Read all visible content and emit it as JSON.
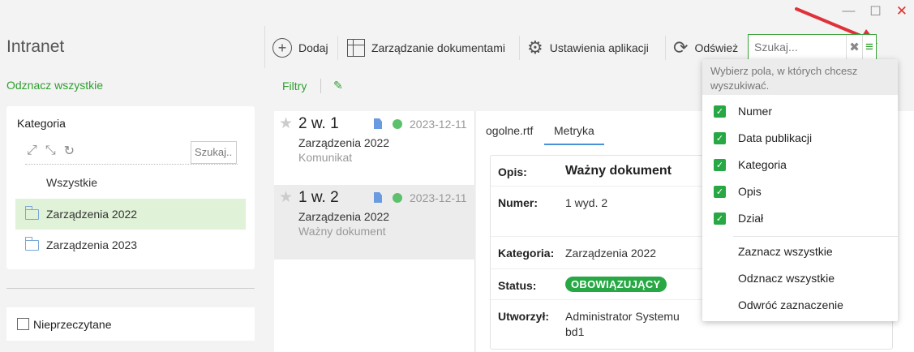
{
  "window": {
    "minimize": "—",
    "maximize": "☐",
    "close": "✕"
  },
  "app": {
    "title": "Intranet"
  },
  "left": {
    "uncheck_all": "Odznacz wszystkie",
    "category_title": "Kategoria",
    "category_search_placeholder": "Szukaj..",
    "categories": [
      "Wszystkie",
      "Zarządzenia 2022",
      "Zarządzenia 2023"
    ],
    "unread_label": "Nieprzeczytane"
  },
  "toolbar": {
    "add": "Dodaj",
    "manage_docs": "Zarządzanie dokumentami",
    "app_settings": "Ustawienia aplikacji",
    "refresh": "Odśwież",
    "search_placeholder": "Szukaj..."
  },
  "filters": {
    "label": "Filtry"
  },
  "documents": [
    {
      "number": "2 w. 1",
      "date": "2023-12-11",
      "category": "Zarządzenia 2022",
      "description": "Komunikat"
    },
    {
      "number": "1 w. 2",
      "date": "2023-12-11",
      "category": "Zarządzenia 2022",
      "description": "Ważny dokument"
    }
  ],
  "tabs": [
    "ogolne.rtf",
    "Metryka"
  ],
  "metadata": {
    "opis_label": "Opis:",
    "opis_value": "Ważny dokument",
    "numer_label": "Numer:",
    "numer_value": "1 wyd. 2",
    "kategoria_label": "Kategoria:",
    "kategoria_value": "Zarządzenia 2022",
    "status_label": "Status:",
    "status_value": "OBOWIĄZUJĄCY",
    "utworzyl_label": "Utworzył:",
    "utworzyl_value_1": "Administrator Systemu",
    "utworzyl_value_2": "bd1"
  },
  "search_fields_menu": {
    "header": "Wybierz pola, w których chcesz wyszukiwać.",
    "fields": [
      "Numer",
      "Data publikacji",
      "Kategoria",
      "Opis",
      "Dział"
    ],
    "actions": [
      "Zaznacz wszystkie",
      "Odznacz wszystkie",
      "Odwróć zaznaczenie"
    ]
  },
  "colors": {
    "accent_green": "#2e9e2e",
    "status_green": "#27a844",
    "arrow_red": "#e0313a",
    "selected_bg": "#e0f2d8"
  }
}
